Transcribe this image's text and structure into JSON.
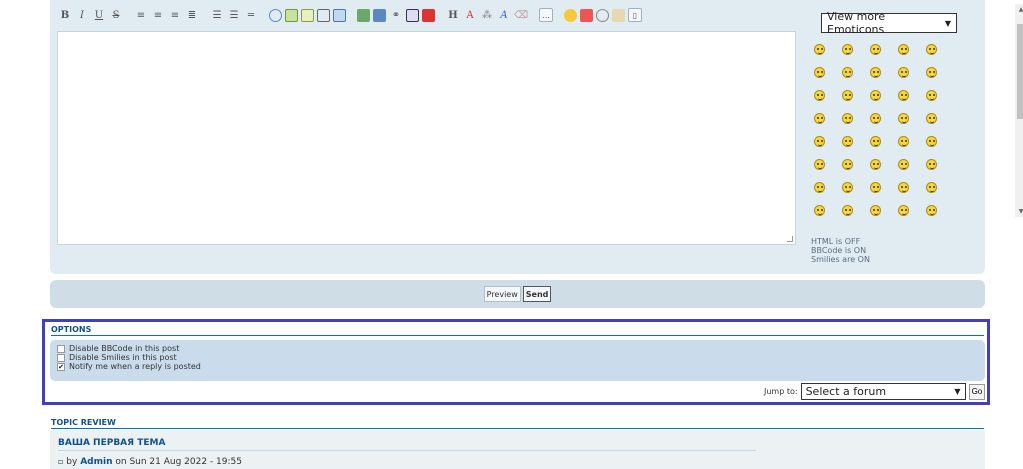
{
  "emoticons": {
    "select_label": "View more Emoticons",
    "count": 40
  },
  "status": {
    "html": "HTML is OFF",
    "bbcode": "BBCode is ON",
    "smilies": "Smilies are ON"
  },
  "submit": {
    "preview_label": "Preview",
    "send_label": "Send"
  },
  "options": {
    "title": "OPTIONS",
    "items": [
      {
        "label": "Disable BBCode in this post",
        "checked": false
      },
      {
        "label": "Disable Smilies in this post",
        "checked": false
      },
      {
        "label": "Notify me when a reply is posted",
        "checked": true
      }
    ]
  },
  "jump": {
    "label": "Jump to:",
    "selected": "Select a forum",
    "go_label": "Go"
  },
  "topic_review": {
    "title": "TOPIC REVIEW",
    "post_title": "ВАША ПЕРВАЯ ТЕМА",
    "by": "by",
    "author": "Admin",
    "on": "on Sun 21 Aug 2022 - 19:55"
  },
  "colors": {
    "panel_bg": "#e1ebf2",
    "frame": "#3f3fbf",
    "heading": "#105289"
  },
  "toolbar_icons": [
    "bold-icon",
    "italic-icon",
    "underline-icon",
    "strike-icon",
    "align-left-icon",
    "align-center-icon",
    "align-right-icon",
    "justify-icon",
    "bullet-list-icon",
    "number-list-icon",
    "hr-icon",
    "quote-icon",
    "code-icon",
    "spoiler-icon",
    "hide-icon",
    "table-icon",
    "image-icon",
    "upload-icon",
    "link-icon",
    "embed-icon",
    "youtube-icon",
    "heading-icon",
    "color-icon",
    "highlight-icon",
    "font-icon",
    "clear-icon",
    "more-icon",
    "smiley-icon",
    "date-icon",
    "other-icon",
    "copy-icon",
    "source-icon"
  ]
}
